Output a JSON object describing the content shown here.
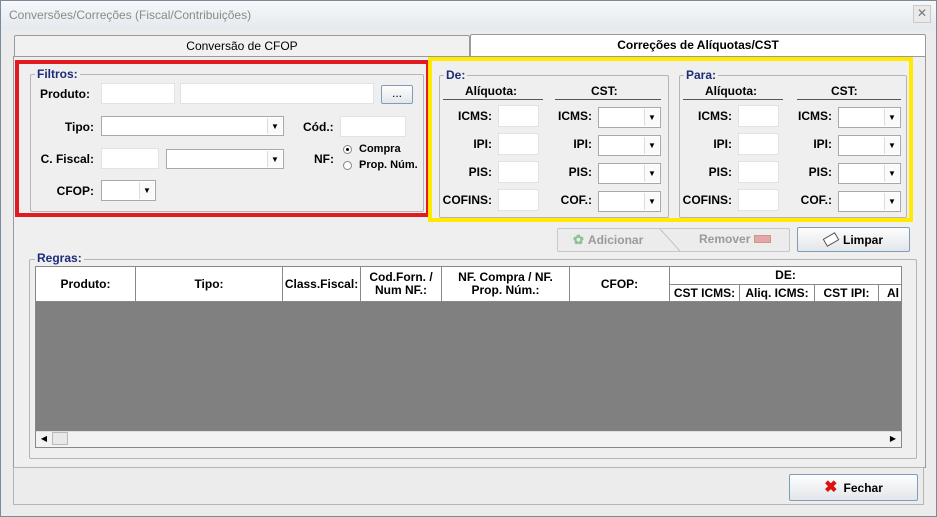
{
  "window": {
    "title": "Conversões/Correções (Fiscal/Contribuições)",
    "close_glyph": "✕"
  },
  "tabs": [
    {
      "label": "Conversão de CFOP",
      "active": false
    },
    {
      "label": "Correções de Alíquotas/CST",
      "active": true
    }
  ],
  "filtros": {
    "title": "Filtros:",
    "produto_label": "Produto:",
    "browse_label": "...",
    "tipo_label": "Tipo:",
    "cod_label": "Cód.:",
    "cfiscal_label": "C. Fiscal:",
    "nf_label": "NF:",
    "nf_options": [
      {
        "label": "Compra",
        "selected": true
      },
      {
        "label": "Prop. Núm.",
        "selected": false
      }
    ],
    "cfop_label": "CFOP:"
  },
  "de": {
    "title": "De:",
    "aliquota_header": "Alíquota:",
    "cst_header": "CST:",
    "aliq_labels": [
      "ICMS:",
      "IPI:",
      "PIS:",
      "COFINS:"
    ],
    "cst_labels": [
      "ICMS:",
      "IPI:",
      "PIS:",
      "COF.:"
    ]
  },
  "para": {
    "title": "Para:",
    "aliquota_header": "Alíquota:",
    "cst_header": "CST:",
    "aliq_labels": [
      "ICMS:",
      "IPI:",
      "PIS:",
      "COFINS:"
    ],
    "cst_labels": [
      "ICMS:",
      "IPI:",
      "PIS:",
      "COF.:"
    ]
  },
  "actions": {
    "adicionar": "Adicionar",
    "remover": "Remover",
    "limpar": "Limpar"
  },
  "regras": {
    "title": "Regras:",
    "columns": [
      "Produto:",
      "Tipo:",
      "Class.Fiscal:",
      "Cod.Forn. / Num NF.:",
      "NF. Compra / NF. Prop. Núm.:",
      "CFOP:"
    ],
    "group_header": "DE:",
    "sub_columns": [
      "CST ICMS:",
      "Aliq. ICMS:",
      "CST IPI:",
      "Al"
    ]
  },
  "footer": {
    "fechar": "Fechar"
  },
  "colors": {
    "highlight_red": "#e21b23",
    "highlight_yellow": "#ffea00",
    "group_title": "#1c2c78",
    "grid_bg": "#808080"
  }
}
